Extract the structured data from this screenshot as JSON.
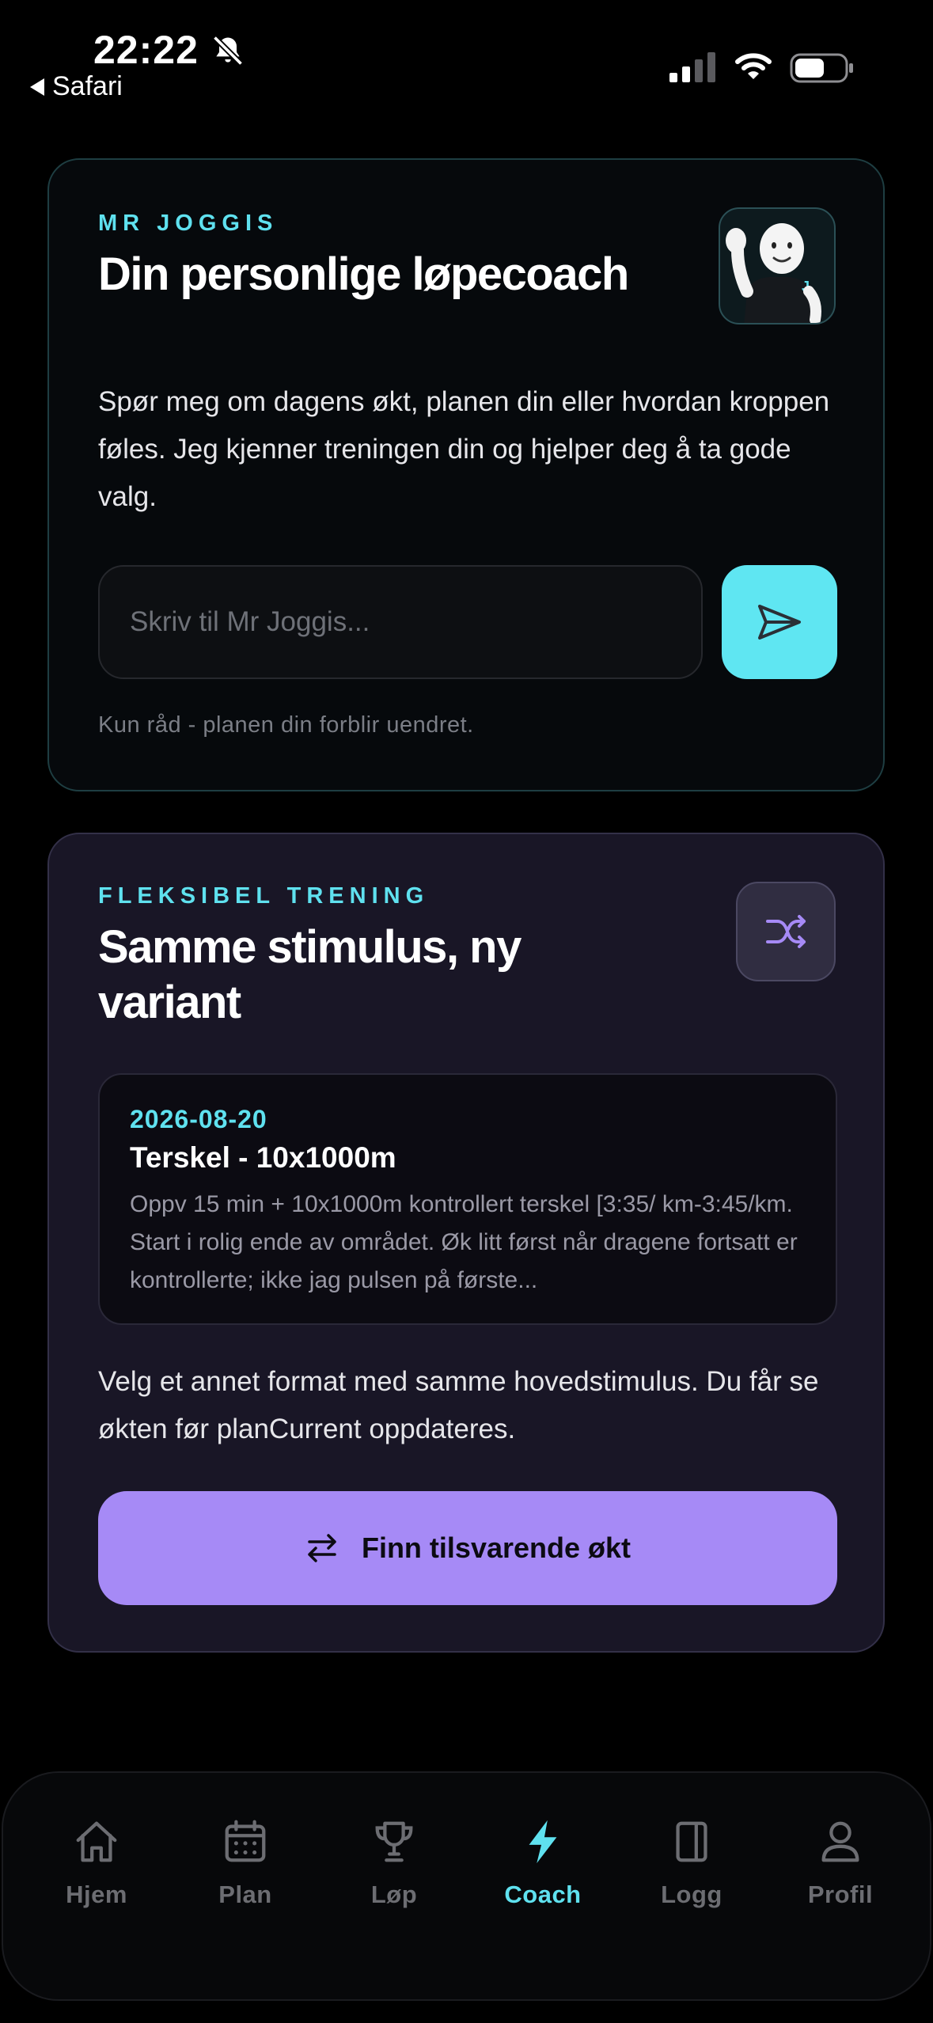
{
  "status_bar": {
    "time": "22:22",
    "back_app": "Safari"
  },
  "colors": {
    "accent_cyan": "#5fe1ef",
    "accent_purple": "#a68af6",
    "background": "#000000"
  },
  "coach": {
    "eyebrow": "MR JOGGIS",
    "title": "Din personlige løpecoach",
    "description": "Spør meg om dagens økt, planen din eller hvordan kroppen føles. Jeg kjenner treningen din og hjelper deg å ta gode valg.",
    "input_placeholder": "Skriv til Mr Joggis...",
    "footnote": "Kun råd - planen din forblir uendret.",
    "avatar_icon": "mascot-waving-icon",
    "send_icon": "send-icon"
  },
  "flexible": {
    "eyebrow": "FLEKSIBEL TRENING",
    "title": "Samme stimulus, ny variant",
    "shuffle_icon": "shuffle-icon",
    "workout": {
      "date": "2026-08-20",
      "name": "Terskel - 10x1000m",
      "description": "Oppv 15 min + 10x1000m kontrollert terskel [3:35/ km-3:45/km. Start i rolig ende av området. Øk litt først når dragene fortsatt er kontrollerte; ikke jag pulsen på første..."
    },
    "description": "Velg et annet format med samme hovedstimulus. Du får se økten før planCurrent oppdateres.",
    "button_label": "Finn tilsvarende økt",
    "button_icon": "swap-arrows-icon"
  },
  "tabs": [
    {
      "label": "Hjem",
      "icon": "home-icon",
      "active": false
    },
    {
      "label": "Plan",
      "icon": "calendar-icon",
      "active": false
    },
    {
      "label": "Løp",
      "icon": "trophy-icon",
      "active": false
    },
    {
      "label": "Coach",
      "icon": "lightning-icon",
      "active": true
    },
    {
      "label": "Logg",
      "icon": "book-icon",
      "active": false
    },
    {
      "label": "Profil",
      "icon": "person-icon",
      "active": false
    }
  ]
}
